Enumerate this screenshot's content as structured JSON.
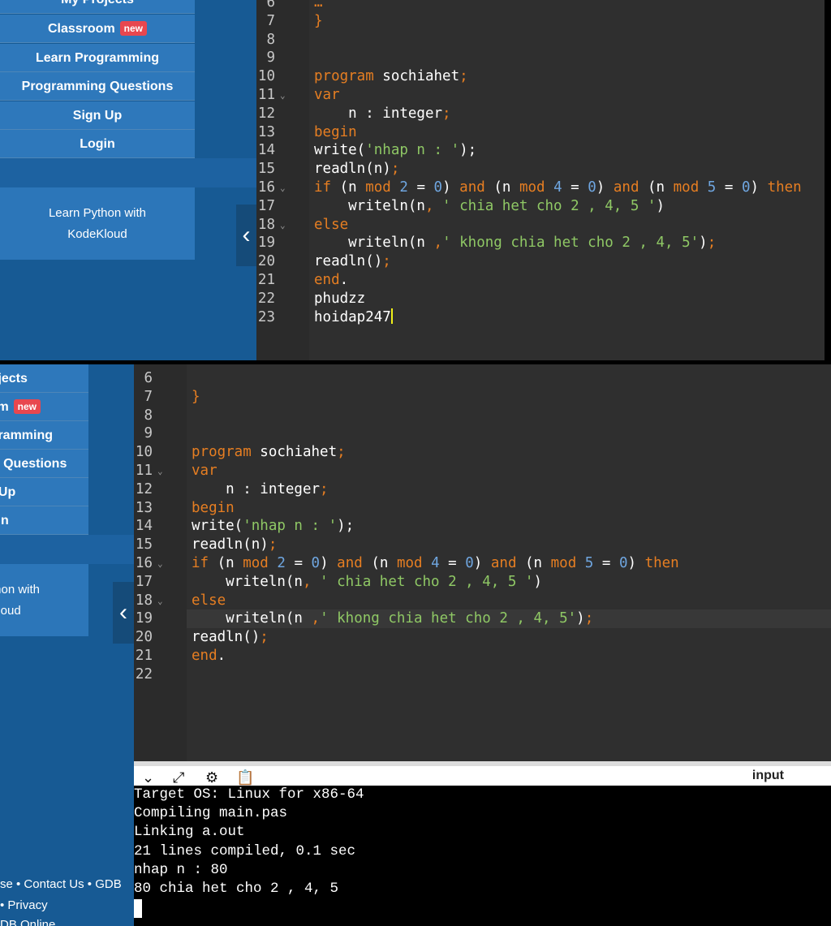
{
  "top": {
    "nav": [
      {
        "label": "My Projects"
      },
      {
        "label": "Classroom",
        "badge": "new"
      },
      {
        "label": "Learn Programming"
      },
      {
        "label": "Programming Questions"
      },
      {
        "label": "Sign Up"
      },
      {
        "label": "Login"
      }
    ],
    "promo": [
      "Learn Python with",
      "KodeKloud"
    ],
    "collapse": "‹",
    "code": [
      {
        "n": "6",
        "t": [
          [
            "…",
            "k"
          ]
        ]
      },
      {
        "n": "7",
        "t": [
          [
            "}",
            "k"
          ]
        ]
      },
      {
        "n": "8",
        "t": []
      },
      {
        "n": "9",
        "t": []
      },
      {
        "n": "10",
        "t": [
          [
            "program",
            "k"
          ],
          [
            " sochiahet",
            "w"
          ],
          [
            ";",
            "p"
          ]
        ]
      },
      {
        "n": "11",
        "fold": true,
        "t": [
          [
            "var",
            "k"
          ]
        ]
      },
      {
        "n": "12",
        "t": [
          [
            "    n : integer",
            "w"
          ],
          [
            ";",
            "p"
          ]
        ]
      },
      {
        "n": "13",
        "t": [
          [
            "begin",
            "k"
          ]
        ]
      },
      {
        "n": "14",
        "t": [
          [
            "write(",
            "w"
          ],
          [
            "'nhap n : '",
            "s"
          ],
          [
            ");",
            "w"
          ]
        ]
      },
      {
        "n": "15",
        "t": [
          [
            "readln(n)",
            "w"
          ],
          [
            ";",
            "p"
          ]
        ]
      },
      {
        "n": "16",
        "fold": true,
        "t": [
          [
            "if",
            "k"
          ],
          [
            " (n ",
            "w"
          ],
          [
            "mod",
            "k"
          ],
          [
            " ",
            "w"
          ],
          [
            "2",
            "n"
          ],
          [
            " = ",
            "w"
          ],
          [
            "0",
            "n"
          ],
          [
            ") ",
            "w"
          ],
          [
            "and",
            "k"
          ],
          [
            " (n ",
            "w"
          ],
          [
            "mod",
            "k"
          ],
          [
            " ",
            "w"
          ],
          [
            "4",
            "n"
          ],
          [
            " = ",
            "w"
          ],
          [
            "0",
            "n"
          ],
          [
            ") ",
            "w"
          ],
          [
            "and",
            "k"
          ],
          [
            " (n ",
            "w"
          ],
          [
            "mod",
            "k"
          ],
          [
            " ",
            "w"
          ],
          [
            "5",
            "n"
          ],
          [
            " = ",
            "w"
          ],
          [
            "0",
            "n"
          ],
          [
            ") ",
            "w"
          ],
          [
            "then",
            "k"
          ]
        ]
      },
      {
        "n": "17",
        "t": [
          [
            "    writeln(n",
            "w"
          ],
          [
            ", ",
            "p"
          ],
          [
            "' chia het cho 2 , 4, 5 '",
            "s"
          ],
          [
            ")",
            "w"
          ]
        ]
      },
      {
        "n": "18",
        "fold": true,
        "t": [
          [
            "else",
            "k"
          ]
        ]
      },
      {
        "n": "19",
        "t": [
          [
            "    writeln(n ",
            "w"
          ],
          [
            ",",
            "p"
          ],
          [
            "' khong chia het cho 2 , 4, 5'",
            "s"
          ],
          [
            ")",
            "w"
          ],
          [
            ";",
            "p"
          ]
        ]
      },
      {
        "n": "20",
        "t": [
          [
            "readln()",
            "w"
          ],
          [
            ";",
            "p"
          ]
        ]
      },
      {
        "n": "21",
        "t": [
          [
            "end",
            "k"
          ],
          [
            ".",
            "w"
          ]
        ]
      },
      {
        "n": "22",
        "t": [
          [
            "phudzz",
            "w"
          ]
        ]
      },
      {
        "n": "23",
        "cursor": true,
        "t": [
          [
            "hoidap247",
            "w"
          ]
        ]
      }
    ]
  },
  "bottom": {
    "nav": [
      {
        "label": "My Projects"
      },
      {
        "label": "Classroom",
        "badge": "new"
      },
      {
        "label": "Learn Programming"
      },
      {
        "label": "Programming Questions"
      },
      {
        "label": "Sign Up"
      },
      {
        "label": "Login"
      }
    ],
    "promo": [
      "Learn Python with",
      "KodeKloud"
    ],
    "collapse": "‹",
    "code": [
      {
        "n": "6",
        "t": []
      },
      {
        "n": "7",
        "t": [
          [
            "}",
            "k"
          ]
        ]
      },
      {
        "n": "8",
        "t": []
      },
      {
        "n": "9",
        "t": []
      },
      {
        "n": "10",
        "t": [
          [
            "program",
            "k"
          ],
          [
            " sochiahet",
            "w"
          ],
          [
            ";",
            "p"
          ]
        ]
      },
      {
        "n": "11",
        "fold": true,
        "t": [
          [
            "var",
            "k"
          ]
        ]
      },
      {
        "n": "12",
        "t": [
          [
            "    n : integer",
            "w"
          ],
          [
            ";",
            "p"
          ]
        ]
      },
      {
        "n": "13",
        "t": [
          [
            "begin",
            "k"
          ]
        ]
      },
      {
        "n": "14",
        "t": [
          [
            "write(",
            "w"
          ],
          [
            "'nhap n : '",
            "s"
          ],
          [
            ");",
            "w"
          ]
        ]
      },
      {
        "n": "15",
        "t": [
          [
            "readln(n)",
            "w"
          ],
          [
            ";",
            "p"
          ]
        ]
      },
      {
        "n": "16",
        "fold": true,
        "t": [
          [
            "if",
            "k"
          ],
          [
            " (n ",
            "w"
          ],
          [
            "mod",
            "k"
          ],
          [
            " ",
            "w"
          ],
          [
            "2",
            "n"
          ],
          [
            " = ",
            "w"
          ],
          [
            "0",
            "n"
          ],
          [
            ") ",
            "w"
          ],
          [
            "and",
            "k"
          ],
          [
            " (n ",
            "w"
          ],
          [
            "mod",
            "k"
          ],
          [
            " ",
            "w"
          ],
          [
            "4",
            "n"
          ],
          [
            " = ",
            "w"
          ],
          [
            "0",
            "n"
          ],
          [
            ") ",
            "w"
          ],
          [
            "and",
            "k"
          ],
          [
            " (n ",
            "w"
          ],
          [
            "mod",
            "k"
          ],
          [
            " ",
            "w"
          ],
          [
            "5",
            "n"
          ],
          [
            " = ",
            "w"
          ],
          [
            "0",
            "n"
          ],
          [
            ") ",
            "w"
          ],
          [
            "then",
            "k"
          ]
        ]
      },
      {
        "n": "17",
        "t": [
          [
            "    writeln(n",
            "w"
          ],
          [
            ", ",
            "p"
          ],
          [
            "' chia het cho 2 , 4, 5 '",
            "s"
          ],
          [
            ")",
            "w"
          ]
        ]
      },
      {
        "n": "18",
        "fold": true,
        "t": [
          [
            "else",
            "k"
          ]
        ]
      },
      {
        "n": "19",
        "active": true,
        "t": [
          [
            "    writeln(n ",
            "w"
          ],
          [
            ",",
            "p"
          ],
          [
            "' khong chia het cho 2 , 4, 5'",
            "s"
          ],
          [
            ")",
            "w"
          ],
          [
            ";",
            "p"
          ]
        ]
      },
      {
        "n": "20",
        "t": [
          [
            "readln()",
            "w"
          ],
          [
            ";",
            "p"
          ]
        ]
      },
      {
        "n": "21",
        "t": [
          [
            "end",
            "k"
          ],
          [
            ".",
            "w"
          ]
        ]
      },
      {
        "n": "22",
        "t": []
      }
    ],
    "terminal": {
      "icons": [
        "chevron-down-icon",
        "expand-icon",
        "gear-icon",
        "clipboard-icon"
      ],
      "input_label": "input",
      "lines": [
        "Target OS: Linux for x86-64",
        "Compiling main.pas",
        "Linking a.out",
        "21 lines compiled, 0.1 sec",
        "nhap n : 80",
        "80 chia het cho 2 , 4, 5"
      ]
    },
    "footer": [
      "se • Contact Us • GDB",
      "• Privacy",
      "DB Online"
    ]
  }
}
